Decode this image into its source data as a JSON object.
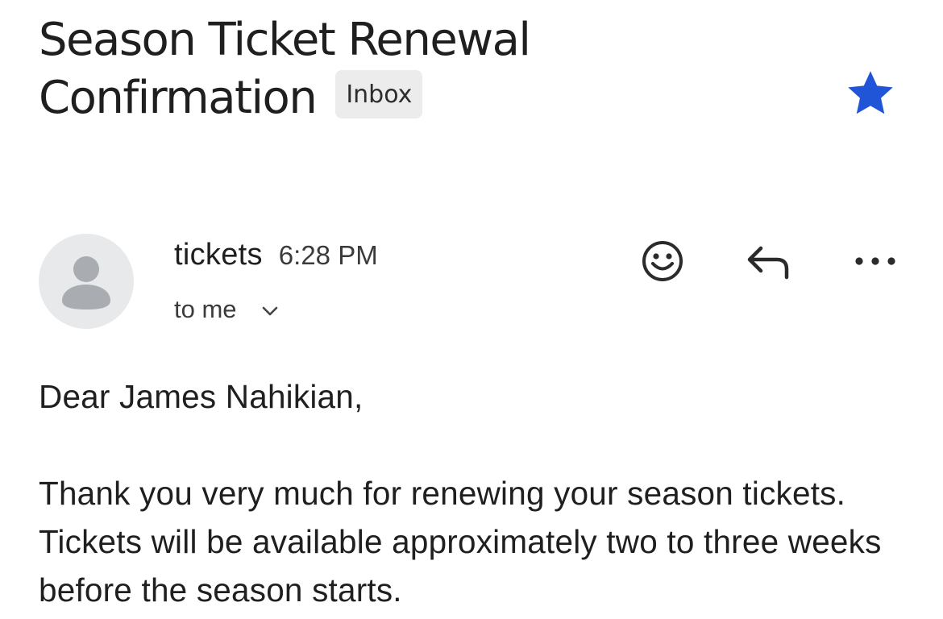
{
  "email": {
    "subject_line1": "Season Ticket Renewal",
    "subject_line2": "Confirmation",
    "label": "Inbox",
    "starred": true,
    "star_color": "#1f55d6",
    "sender": {
      "name": "tickets",
      "time": "6:28 PM",
      "recipient": "to me",
      "avatar_icon": "person-silhouette-icon"
    },
    "actions": {
      "emoji_icon": "smiley-face-icon",
      "reply_icon": "reply-arrow-icon",
      "more_icon": "more-horizontal-icon"
    },
    "body": {
      "greeting": "Dear James Nahikian,",
      "paragraph": "Thank you very much for renewing your season tickets. Tickets will be available approximately two to three weeks before the season starts."
    }
  }
}
